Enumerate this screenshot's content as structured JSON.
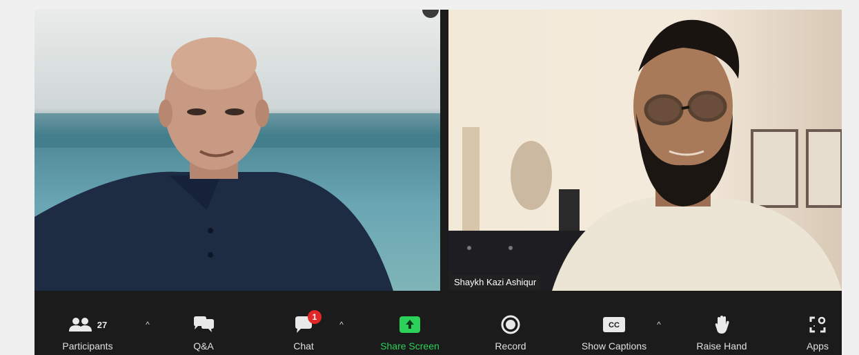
{
  "tiles": {
    "right_name": "Shaykh Kazi Ashiqur"
  },
  "toolbar": {
    "participants": {
      "label": "Participants",
      "count": "27",
      "icon": "participants-icon"
    },
    "qa": {
      "label": "Q&A",
      "icon": "qa-icon"
    },
    "chat": {
      "label": "Chat",
      "badge": "1",
      "icon": "chat-icon"
    },
    "share": {
      "label": "Share Screen",
      "icon": "share-screen-icon"
    },
    "record": {
      "label": "Record",
      "icon": "record-icon"
    },
    "captions": {
      "label": "Show Captions",
      "icon_text": "CC",
      "icon": "cc-icon"
    },
    "raise_hand": {
      "label": "Raise Hand",
      "icon": "hand-icon"
    },
    "apps": {
      "label": "Apps",
      "icon": "apps-icon"
    },
    "caret": "^"
  },
  "colors": {
    "toolbar_bg": "#1b1b1b",
    "share_green": "#2bd158",
    "badge_red": "#e02828"
  }
}
